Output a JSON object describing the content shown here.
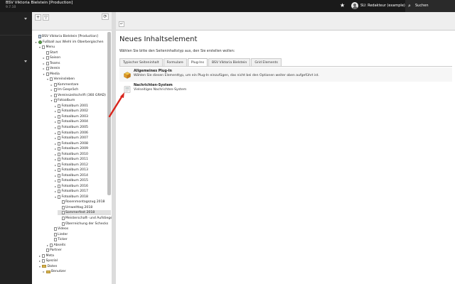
{
  "header": {
    "site_title": "BSV Viktoria Bielstein [Production]",
    "version": "9.7.10",
    "user": "SU: Redakteur (example)",
    "search": "Suchen"
  },
  "page_tree": {
    "nodes": [
      {
        "label": "BSV Viktoria Bielstein [Production]",
        "level": 0,
        "icon": "root",
        "exp": ""
      },
      {
        "label": "Fußball aus Wiehl im Oberbergischen",
        "level": 0,
        "icon": "globe",
        "exp": "▾"
      },
      {
        "label": "Menu",
        "level": 1,
        "icon": "page",
        "exp": "▾"
      },
      {
        "label": "Start",
        "level": 2,
        "icon": "page",
        "exp": ""
      },
      {
        "label": "Saison",
        "level": 2,
        "icon": "page",
        "exp": "▸"
      },
      {
        "label": "Teams",
        "level": 2,
        "icon": "page",
        "exp": "▸"
      },
      {
        "label": "Verein",
        "level": 2,
        "icon": "page",
        "exp": "▸"
      },
      {
        "label": "Media",
        "level": 2,
        "icon": "page",
        "exp": "▾"
      },
      {
        "label": "Vereinsleben",
        "level": 3,
        "icon": "page",
        "exp": "▾"
      },
      {
        "label": "Kommentare",
        "level": 4,
        "icon": "page",
        "exp": "▸"
      },
      {
        "label": "Im Gespräch",
        "level": 4,
        "icon": "page",
        "exp": "▸"
      },
      {
        "label": "Vereinszeitschrift (360 GRAD)",
        "level": 4,
        "icon": "page",
        "exp": "▸"
      },
      {
        "label": "Fotoalbum",
        "level": 4,
        "icon": "page",
        "exp": "▾"
      },
      {
        "label": "Fotoalbum 2001",
        "level": 5,
        "icon": "page",
        "exp": "▸"
      },
      {
        "label": "Fotoalbum 2002",
        "level": 5,
        "icon": "page",
        "exp": "▸"
      },
      {
        "label": "Fotoalbum 2003",
        "level": 5,
        "icon": "page",
        "exp": "▸"
      },
      {
        "label": "Fotoalbum 2004",
        "level": 5,
        "icon": "page",
        "exp": "▸"
      },
      {
        "label": "Fotoalbum 2005",
        "level": 5,
        "icon": "page",
        "exp": "▸"
      },
      {
        "label": "Fotoalbum 2006",
        "level": 5,
        "icon": "page",
        "exp": "▸"
      },
      {
        "label": "Fotoalbum 2007",
        "level": 5,
        "icon": "page",
        "exp": "▸"
      },
      {
        "label": "Fotoalbum 2008",
        "level": 5,
        "icon": "page",
        "exp": "▸"
      },
      {
        "label": "Fotoalbum 2009",
        "level": 5,
        "icon": "page",
        "exp": "▸"
      },
      {
        "label": "Fotoalbum 2010",
        "level": 5,
        "icon": "page",
        "exp": "▸"
      },
      {
        "label": "Fotoalbum 2011",
        "level": 5,
        "icon": "page",
        "exp": "▸"
      },
      {
        "label": "Fotoalbum 2012",
        "level": 5,
        "icon": "page",
        "exp": "▸"
      },
      {
        "label": "Fotoalbum 2013",
        "level": 5,
        "icon": "page",
        "exp": "▸"
      },
      {
        "label": "Fotoalbum 2014",
        "level": 5,
        "icon": "page",
        "exp": "▸"
      },
      {
        "label": "Fotoalbum 2015",
        "level": 5,
        "icon": "page",
        "exp": "▸"
      },
      {
        "label": "Fotoalbum 2016",
        "level": 5,
        "icon": "page",
        "exp": "▸"
      },
      {
        "label": "Fotoalbum 2017",
        "level": 5,
        "icon": "page",
        "exp": "▸"
      },
      {
        "label": "Fotoalbum 2018",
        "level": 5,
        "icon": "page",
        "exp": "▾"
      },
      {
        "label": "Rosenmontagszug 2018",
        "level": 6,
        "icon": "page",
        "exp": ""
      },
      {
        "label": "Umwelttag 2018",
        "level": 6,
        "icon": "page",
        "exp": ""
      },
      {
        "label": "Sommerfest 2018",
        "level": 6,
        "icon": "page",
        "exp": "",
        "highlight": true
      },
      {
        "label": "Meisterschaft- und Aufstiegsfeier",
        "level": 6,
        "icon": "page",
        "exp": ""
      },
      {
        "label": "Überreichung der Schecks",
        "level": 6,
        "icon": "page",
        "exp": ""
      },
      {
        "label": "Videos",
        "level": 4,
        "icon": "page",
        "exp": ""
      },
      {
        "label": "Lieder",
        "level": 4,
        "icon": "page",
        "exp": ""
      },
      {
        "label": "Ticker",
        "level": 4,
        "icon": "page",
        "exp": ""
      },
      {
        "label": "Abseits",
        "level": 3,
        "icon": "page",
        "exp": "▸"
      },
      {
        "label": "Partner",
        "level": 2,
        "icon": "page",
        "exp": ""
      },
      {
        "label": "Meta",
        "level": 1,
        "icon": "page",
        "exp": "▸"
      },
      {
        "label": "Spezial",
        "level": 1,
        "icon": "page",
        "exp": "▸"
      },
      {
        "label": "Daten",
        "level": 1,
        "icon": "folder",
        "exp": "▾"
      },
      {
        "label": "Benutzer",
        "level": 2,
        "icon": "folder",
        "exp": "▸"
      }
    ]
  },
  "main": {
    "title": "Neues Inhaltselement",
    "instructions": "Wählen Sie bitte den Seiteninhaltstyp aus, den Sie erstellen wollen:",
    "tabs": [
      {
        "label": "Typischer Seiteninhalt",
        "active": false
      },
      {
        "label": "Formulare",
        "active": false
      },
      {
        "label": "Plug-Ins",
        "active": true
      },
      {
        "label": "BSV Viktoria Bielstein",
        "active": false
      },
      {
        "label": "Grid Elements",
        "active": false
      }
    ],
    "items": [
      {
        "title": "Allgemeines Plug-In",
        "description": "Wählen Sie diesen Elementtyp, um ein Plug-In einzufügen, das nicht bei den Optionen weiter oben aufgeführt ist."
      },
      {
        "title": "Nachrichten-System",
        "description": "Vielseitiges Nachrichten-System"
      }
    ]
  },
  "icons": {
    "star": "star-icon",
    "search": "search-icon",
    "refresh": "refresh-icon",
    "close": "close-icon",
    "plugin": "plugin-cube-icon",
    "news": "news-icon"
  },
  "colors": {
    "topbar": "#1a1a1a",
    "module_menu": "#222222",
    "annotation_arrow": "#d9251c"
  }
}
